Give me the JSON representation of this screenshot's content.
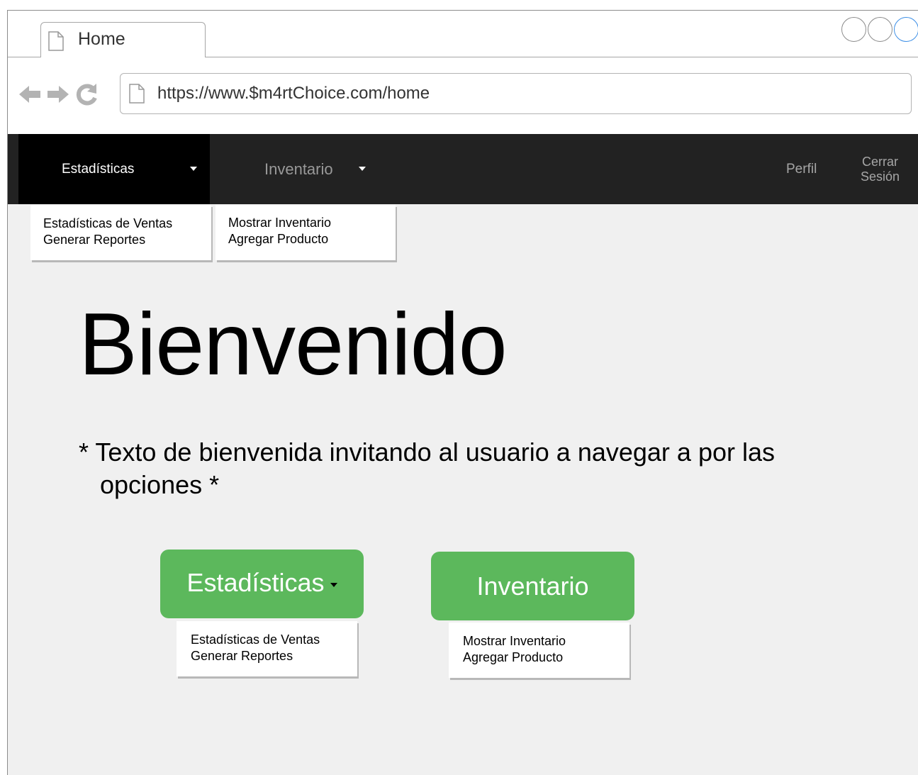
{
  "browser": {
    "tab_title": "Home",
    "url": "https://www.$m4rtChoice.com/home"
  },
  "navbar": {
    "estadisticas": "Estadísticas",
    "inventario": "Inventario",
    "perfil": "Perfil",
    "cerrar_line1": "Cerrar",
    "cerrar_line2": "Sesión"
  },
  "menus": {
    "estadisticas": [
      "Estadísticas de Ventas",
      "Generar Reportes"
    ],
    "inventario": [
      "Mostrar Inventario",
      "Agregar Producto"
    ]
  },
  "main": {
    "title": "Bienvenido",
    "welcome_text": "* Texto de bienvenida invitando al usuario a navegar a por las opciones *",
    "btn_estadisticas": "Estadísticas",
    "btn_inventario": "Inventario"
  },
  "colors": {
    "navbar_bg": "#222222",
    "active_nav_bg": "#000000",
    "button_green": "#5cb85c",
    "page_bg": "#f0f0f0"
  }
}
